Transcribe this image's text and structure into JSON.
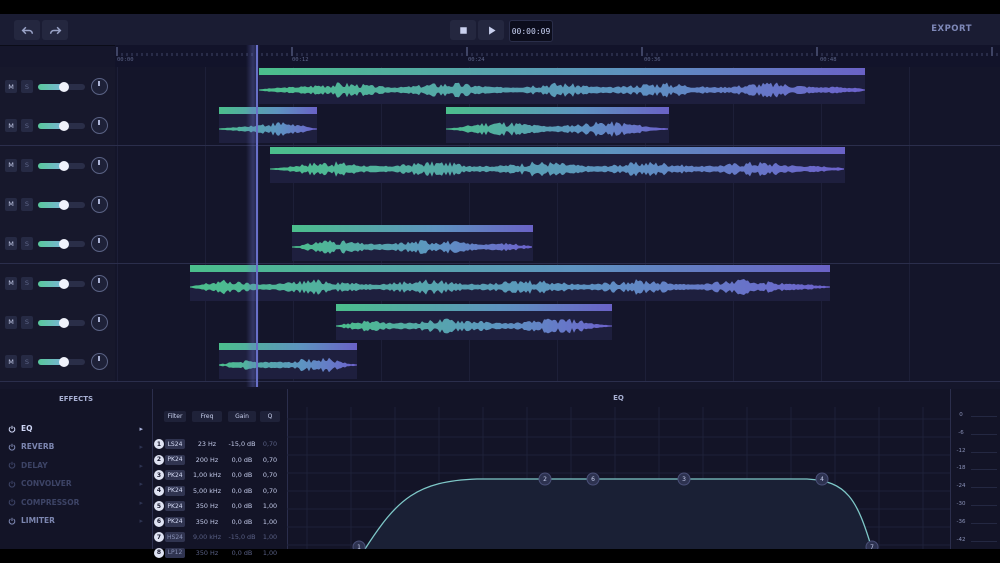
{
  "toolbar": {
    "undo_icon": "undo-icon",
    "redo_icon": "redo-icon",
    "stop_icon": "stop-icon",
    "play_icon": "play-icon",
    "time": "00:00:09",
    "export_label": "EXPORT"
  },
  "ruler": {
    "labels": [
      "00:00",
      "00:12",
      "00:24",
      "00:36",
      "00:48"
    ]
  },
  "tracks": [
    {
      "mute": "M",
      "solo": "S",
      "volume": 0.55
    },
    {
      "mute": "M",
      "solo": "S",
      "volume": 0.55
    },
    {
      "mute": "M",
      "solo": "S",
      "volume": 0.55
    },
    {
      "mute": "M",
      "solo": "S",
      "volume": 0.55
    },
    {
      "mute": "M",
      "solo": "S",
      "volume": 0.55
    },
    {
      "mute": "M",
      "solo": "S",
      "volume": 0.55
    },
    {
      "mute": "M",
      "solo": "S",
      "volume": 0.55
    },
    {
      "mute": "M",
      "solo": "S",
      "volume": 0.55
    }
  ],
  "effects": {
    "title": "EFFECTS",
    "items": [
      {
        "label": "EQ",
        "state": "selected"
      },
      {
        "label": "REVERB",
        "state": "on"
      },
      {
        "label": "DELAY",
        "state": "off"
      },
      {
        "label": "CONVOLVER",
        "state": "off"
      },
      {
        "label": "COMPRESSOR",
        "state": "off"
      },
      {
        "label": "LIMITER",
        "state": "on"
      }
    ]
  },
  "eq": {
    "title": "EQ",
    "headers": [
      "Filter",
      "Freq",
      "Gain",
      "Q"
    ],
    "bands": [
      {
        "n": "1",
        "filter": "LS24",
        "freq": "23 Hz",
        "gain": "-15,0 dB",
        "q": "0,70",
        "dim_q": true
      },
      {
        "n": "2",
        "filter": "PK24",
        "freq": "200 Hz",
        "gain": "0,0 dB",
        "q": "0,70"
      },
      {
        "n": "3",
        "filter": "PK24",
        "freq": "1,00 kHz",
        "gain": "0,0 dB",
        "q": "0,70"
      },
      {
        "n": "4",
        "filter": "PK24",
        "freq": "5,00 kHz",
        "gain": "0,0 dB",
        "q": "0,70"
      },
      {
        "n": "5",
        "filter": "PK24",
        "freq": "350 Hz",
        "gain": "0,0 dB",
        "q": "1,00"
      },
      {
        "n": "6",
        "filter": "PK24",
        "freq": "350 Hz",
        "gain": "0,0 dB",
        "q": "1,00"
      },
      {
        "n": "7",
        "filter": "HS24",
        "freq": "9,00 kHz",
        "gain": "-15,0 dB",
        "q": "1,00",
        "dim": true
      },
      {
        "n": "8",
        "filter": "LP12",
        "freq": "350 Hz",
        "gain": "0,0 dB",
        "q": "1,00",
        "dim": true
      }
    ],
    "nodes": [
      "2",
      "6",
      "3",
      "4",
      "1",
      "7"
    ]
  },
  "meter": {
    "labels": [
      "0",
      "-6",
      "-12",
      "-18",
      "-24",
      "-30",
      "-36",
      "-42"
    ]
  },
  "colors": {
    "accent_green": "#4bbf8c",
    "accent_purple": "#6a62c6",
    "background": "#15162b"
  }
}
